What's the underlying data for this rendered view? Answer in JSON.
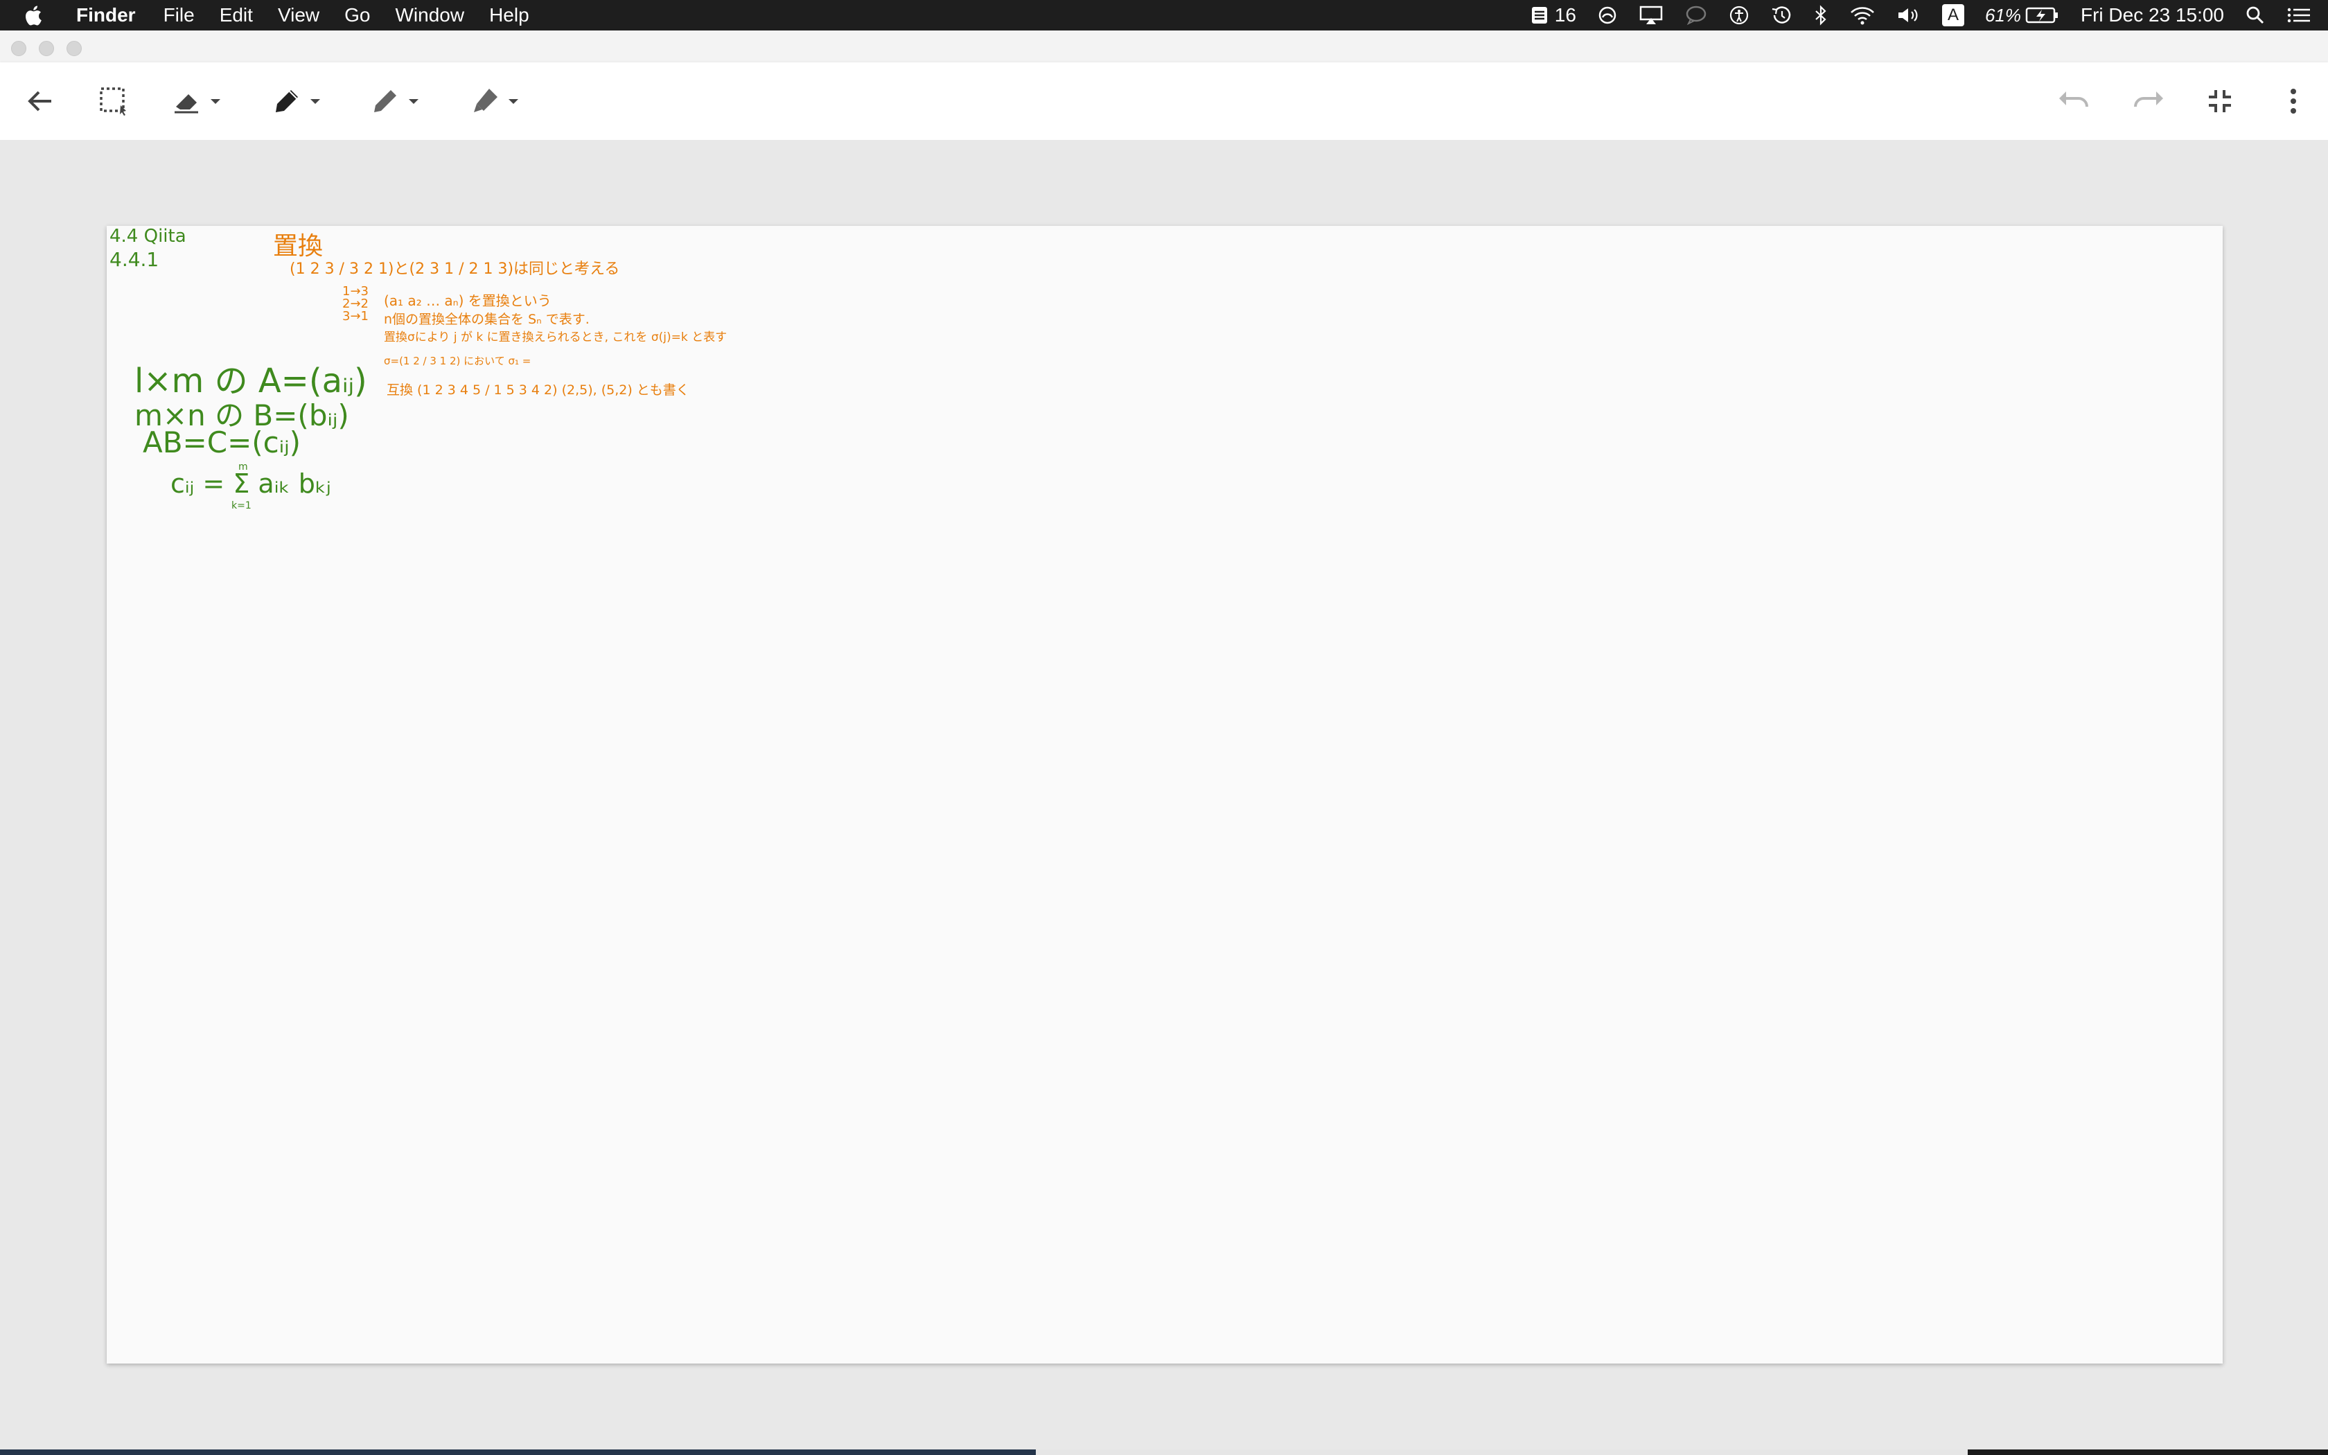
{
  "menubar": {
    "app_name": "Finder",
    "items": [
      "File",
      "Edit",
      "View",
      "Go",
      "Window",
      "Help"
    ],
    "status": {
      "notification_count": "16",
      "input_source": "A",
      "battery": "61%",
      "clock": "Fri Dec 23  15:00"
    }
  },
  "toolbar": {
    "icons": [
      "back-arrow-icon",
      "lasso-select-icon",
      "eraser-icon",
      "pen-icon",
      "pencil-icon",
      "highlighter-icon",
      "undo-icon",
      "redo-icon",
      "exit-fullscreen-icon",
      "more-vertical-icon"
    ],
    "ink_color": "#444444",
    "disabled_color": "#b8b8b8"
  },
  "notes": {
    "heading_green_1": "4.4 Qiita",
    "heading_green_2": "4.4.1",
    "orange_title": "置換",
    "orange_line1": "(1 2 3 / 3 2 1)と(2 3 1 / 2 1 3)は同じと考える",
    "orange_map": "1→3  2→2  3→1",
    "orange_line2": "(a₁ a₂ … aₙ) を置換という",
    "orange_line3": "n個の置換全体の集合を Sₙ で表す.",
    "orange_line4": "置換σにより j が k に置き換えられるとき, これを σ(j)=k と表す",
    "orange_line5": "σ=(1 2 / 3 1 2) において σ₁ =",
    "orange_line6": "互換 (1 2 3 4 5 / 1 5 3 4 2)  (2,5), (5,2) とも書く",
    "green_line1": "l×m の A=(aᵢⱼ)",
    "green_line2": "m×n の B=(bᵢⱼ)",
    "green_line3": "AB=C=(cᵢⱼ)",
    "green_line4": "cᵢⱼ = Σ aᵢₖ bₖⱼ",
    "sum_upper": "m",
    "sum_lower": "k=1"
  },
  "colors": {
    "orange_ink": "#e87f0e",
    "green_ink": "#3f8a1e"
  }
}
